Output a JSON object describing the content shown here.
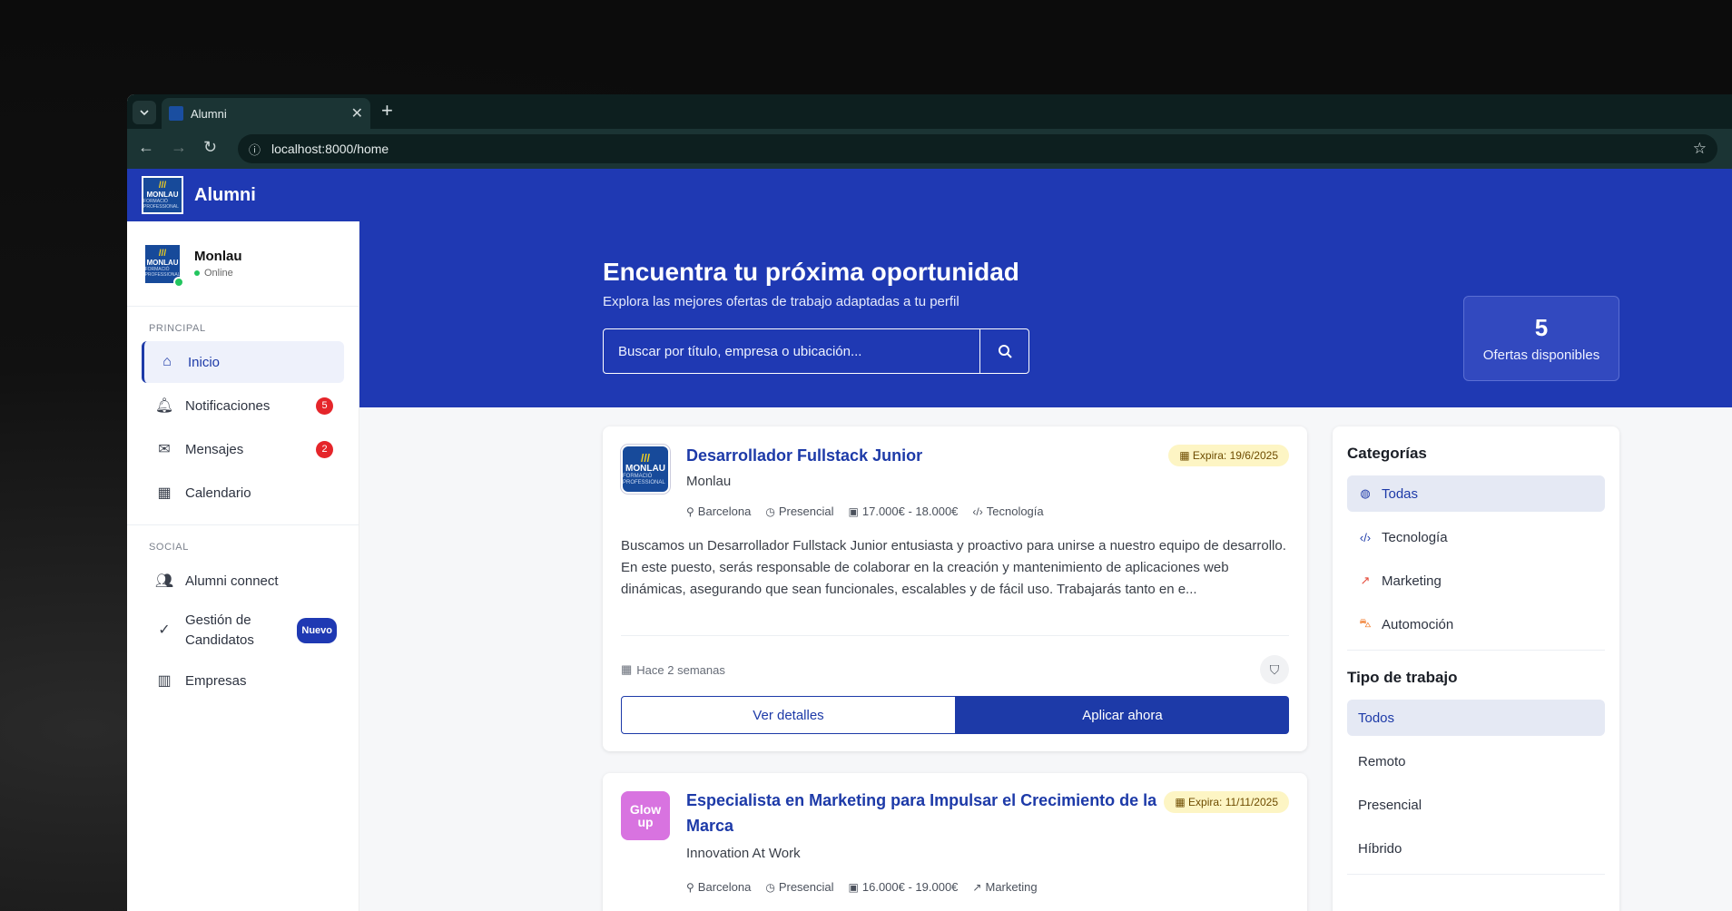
{
  "browser": {
    "tab_title": "Alumni",
    "url": "localhost:8000/home"
  },
  "app": {
    "title": "Alumni",
    "logo_line1": "///",
    "logo_line2": "MONLAU",
    "logo_line3": "FORMACIÓ PROFESSIONAL"
  },
  "profile": {
    "name": "Monlau",
    "status": "Online"
  },
  "sidebar": {
    "section_principal": "PRINCIPAL",
    "section_social": "SOCIAL",
    "items": [
      {
        "label": "Inicio",
        "icon": "home-icon"
      },
      {
        "label": "Notificaciones",
        "icon": "bell-icon",
        "badge": "5"
      },
      {
        "label": "Mensajes",
        "icon": "mail-icon",
        "badge": "2"
      },
      {
        "label": "Calendario",
        "icon": "calendar-icon"
      },
      {
        "label": "Alumni connect",
        "icon": "users-icon"
      },
      {
        "label": "Gestión de Candidatos",
        "icon": "user-check-icon",
        "badge": "Nuevo"
      },
      {
        "label": "Empresas",
        "icon": "building-icon"
      }
    ]
  },
  "hero": {
    "title": "Encuentra tu próxima oportunidad",
    "subtitle": "Explora las mejores ofertas de trabajo adaptadas a tu perfil",
    "search_placeholder": "Buscar por título, empresa o ubicación...",
    "stat_number": "5",
    "stat_label": "Ofertas disponibles"
  },
  "jobs": [
    {
      "title": "Desarrollador Fullstack Junior",
      "company": "Monlau",
      "expires": "Expira: 19/6/2025",
      "location": "Barcelona",
      "modality": "Presencial",
      "salary": "17.000€ - 18.000€",
      "category": "Tecnología",
      "description": "Buscamos un Desarrollador Fullstack Junior entusiasta y proactivo para unirse a nuestro equipo de desarrollo. En este puesto, serás responsable de colaborar en la creación y mantenimiento de aplicaciones web dinámicas, asegurando que sean funcionales, escalables y de fácil uso. Trabajarás tanto en e...",
      "posted": "Hace 2 semanas",
      "details_label": "Ver detalles",
      "apply_label": "Aplicar ahora"
    },
    {
      "title": "Especialista en Marketing para Impulsar el Crecimiento de la Marca",
      "company": "Innovation At Work",
      "expires": "Expira: 11/11/2025",
      "location": "Barcelona",
      "modality": "Presencial",
      "salary": "16.000€ - 19.000€",
      "category": "Marketing",
      "logo_text": "Glow up"
    }
  ],
  "filters": {
    "categories_title": "Categorías",
    "categories": [
      {
        "label": "Todas",
        "icon": "globe-icon"
      },
      {
        "label": "Tecnología",
        "icon": "code-icon"
      },
      {
        "label": "Marketing",
        "icon": "chart-icon"
      },
      {
        "label": "Automoción",
        "icon": "car-icon"
      }
    ],
    "type_title": "Tipo de trabajo",
    "types": [
      "Todos",
      "Remoto",
      "Presencial",
      "Híbrido"
    ]
  },
  "colors": {
    "brand_blue": "#1f39b3",
    "accent_blue": "#1d3aa8",
    "badge_red": "#e5252a",
    "online_green": "#22c55e"
  }
}
